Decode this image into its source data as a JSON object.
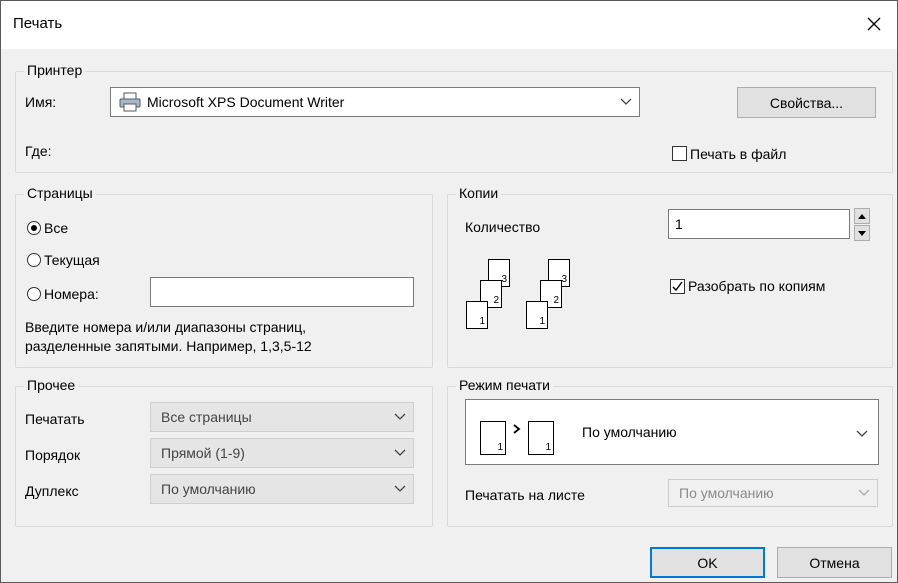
{
  "title": "Печать",
  "printer": {
    "legend": "Принтер",
    "name_label": "Имя:",
    "name_value": "Microsoft XPS Document Writer",
    "where_label": "Где:",
    "properties_button": "Свойства...",
    "print_to_file": "Печать в файл",
    "print_to_file_checked": false
  },
  "pages": {
    "legend": "Страницы",
    "options": [
      "Все",
      "Текущая",
      "Номера:"
    ],
    "selected": 0,
    "numbers_value": "",
    "hint_line1": "Введите номера и/или диапазоны страниц,",
    "hint_line2": "разделенные запятыми. Например, 1,3,5-12"
  },
  "copies": {
    "legend": "Копии",
    "count_label": "Количество",
    "count_value": "1",
    "collate_label": "Разобрать по копиям",
    "collate_checked": true,
    "sheet_numbers": [
      "3",
      "2",
      "1"
    ]
  },
  "other": {
    "legend": "Прочее",
    "rows": [
      {
        "label": "Печатать",
        "value": "Все страницы"
      },
      {
        "label": "Порядок",
        "value": "Прямой (1-9)"
      },
      {
        "label": "Дуплекс",
        "value": "По умолчанию"
      }
    ]
  },
  "print_mode": {
    "legend": "Режим печати",
    "mode_value": "По умолчанию",
    "sheet_numbers": [
      "1",
      "1"
    ],
    "per_sheet_label": "Печатать на листе",
    "per_sheet_value": "По умолчанию"
  },
  "buttons": {
    "ok": "OK",
    "cancel": "Отмена"
  },
  "colors": {
    "accent": "#0078d7",
    "dialog_bg": "#f0f0f0",
    "border": "#d9d9d9"
  }
}
